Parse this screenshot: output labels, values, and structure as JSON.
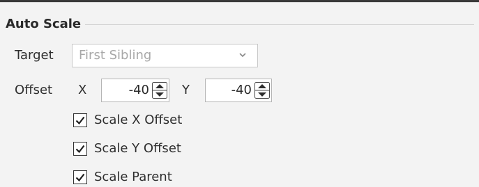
{
  "group": {
    "title": "Auto Scale"
  },
  "target": {
    "label": "Target",
    "selected": "First Sibling"
  },
  "offset": {
    "label": "Offset",
    "x_label": "X",
    "x_value": "-40",
    "y_label": "Y",
    "y_value": "-40"
  },
  "checkboxes": [
    {
      "label": "Scale X Offset",
      "checked": true
    },
    {
      "label": "Scale Y Offset",
      "checked": true
    },
    {
      "label": "Scale Parent",
      "checked": true
    }
  ],
  "icons": {
    "dropdown": "chevron-down-icon",
    "spinner": "spin-up-down-icon",
    "check": "checkmark-icon"
  }
}
